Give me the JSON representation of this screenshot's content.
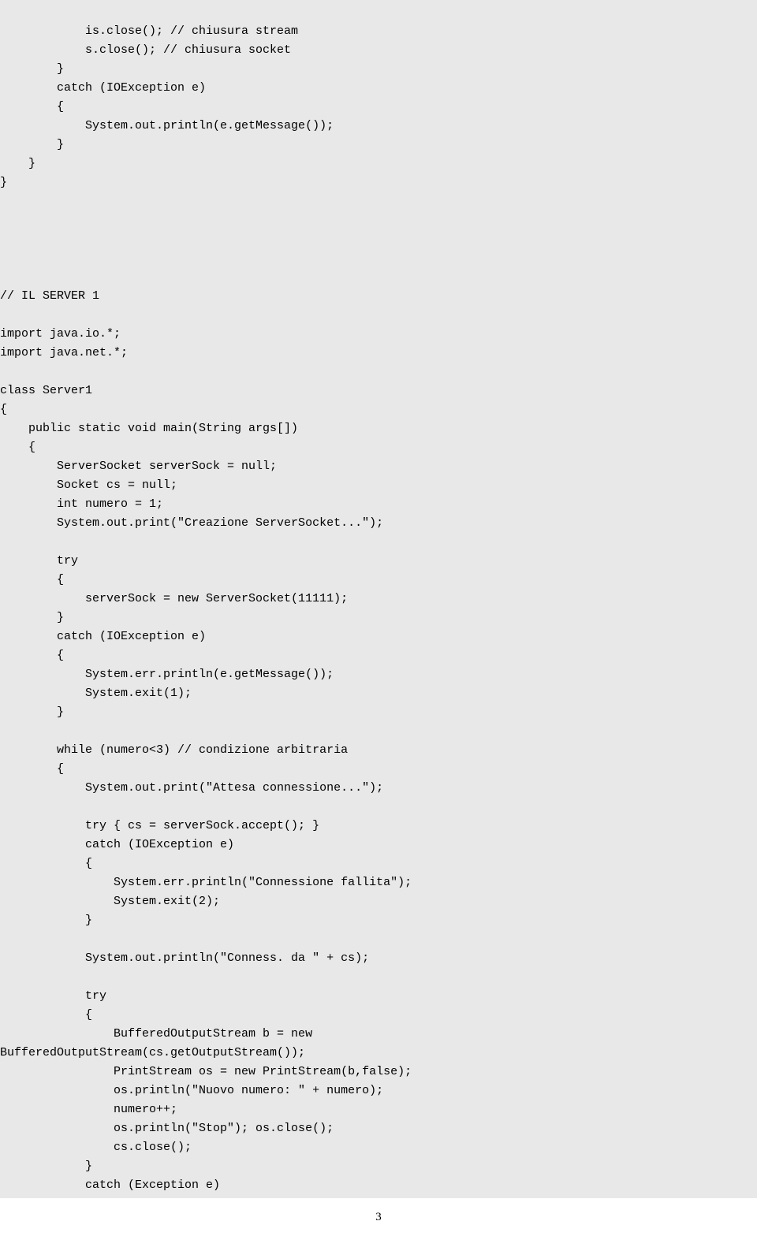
{
  "code": {
    "line1": "            is.close(); // chiusura stream",
    "line2": "            s.close(); // chiusura socket",
    "line3": "        }",
    "line4": "        catch (IOException e)",
    "line5": "        {",
    "line6": "            System.out.println(e.getMessage());",
    "line7": "        }",
    "line8": "    }",
    "line9": "}",
    "line10": "",
    "line11": "",
    "line12": "",
    "line13": "",
    "line14": "",
    "line15": "// IL SERVER 1",
    "line16": "",
    "line17": "import java.io.*;",
    "line18": "import java.net.*;",
    "line19": "",
    "line20": "class Server1",
    "line21": "{",
    "line22": "    public static void main(String args[])",
    "line23": "    {",
    "line24": "        ServerSocket serverSock = null;",
    "line25": "        Socket cs = null;",
    "line26": "        int numero = 1;",
    "line27": "        System.out.print(\"Creazione ServerSocket...\");",
    "line28": "",
    "line29": "        try",
    "line30": "        {",
    "line31": "            serverSock = new ServerSocket(11111);",
    "line32": "        }",
    "line33": "        catch (IOException e)",
    "line34": "        {",
    "line35": "            System.err.println(e.getMessage());",
    "line36": "            System.exit(1);",
    "line37": "        }",
    "line38": "",
    "line39": "        while (numero<3) // condizione arbitraria",
    "line40": "        {",
    "line41": "            System.out.print(\"Attesa connessione...\");",
    "line42": "",
    "line43": "            try { cs = serverSock.accept(); }",
    "line44": "            catch (IOException e)",
    "line45": "            {",
    "line46": "                System.err.println(\"Connessione fallita\");",
    "line47": "                System.exit(2);",
    "line48": "            }",
    "line49": "",
    "line50": "            System.out.println(\"Conness. da \" + cs);",
    "line51": "",
    "line52": "            try",
    "line53": "            {",
    "line54": "                BufferedOutputStream b = new",
    "line55": "BufferedOutputStream(cs.getOutputStream());",
    "line56": "                PrintStream os = new PrintStream(b,false);",
    "line57": "                os.println(\"Nuovo numero: \" + numero);",
    "line58": "                numero++;",
    "line59": "                os.println(\"Stop\"); os.close();",
    "line60": "                cs.close();",
    "line61": "            }",
    "line62": "            catch (Exception e)"
  },
  "pageNumber": "3"
}
